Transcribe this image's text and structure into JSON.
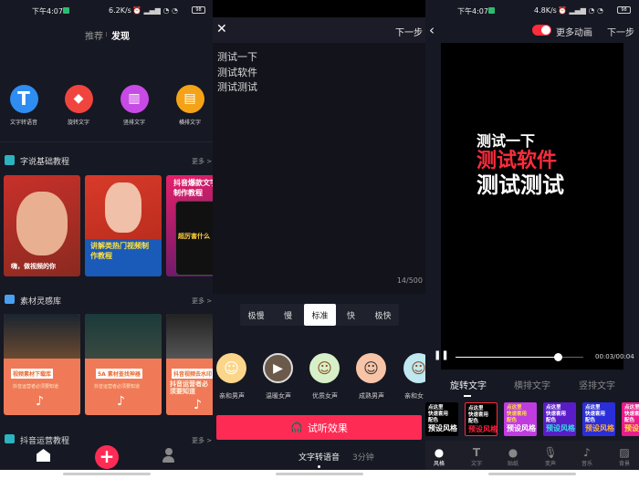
{
  "panel1": {
    "status": {
      "time": "下午4:07",
      "speed": "6.2K/s",
      "battery": "98"
    },
    "tabs": [
      {
        "label": "推荐",
        "active": false
      },
      {
        "label": "发现",
        "active": true
      }
    ],
    "tools": [
      {
        "label": "文字转语音",
        "icon": "text-t-icon",
        "color": "#2f8cf0"
      },
      {
        "label": "旋转文字",
        "icon": "rotate-text-icon",
        "color": "#f0453f"
      },
      {
        "label": "竖排文字",
        "icon": "vertical-text-icon",
        "color": "#c84ae6"
      },
      {
        "label": "横排文字",
        "icon": "horizontal-text-icon",
        "color": "#f5a316"
      }
    ],
    "sections": [
      {
        "title": "字说基础教程",
        "more": "更多 >",
        "cards": [
          {
            "caption": "嗨，做视频的你"
          },
          {
            "caption": "讲解类热门视频制作教程"
          },
          {
            "caption": "抖音爆款文字制作教程",
            "sub": "超厉害什么"
          }
        ]
      },
      {
        "title": "素材灵感库",
        "more": "更多 >",
        "cards": [
          {
            "caption": "视频素材下载库",
            "sub": "抖音运营者必须要知道"
          },
          {
            "caption": "5A 素材查找神器",
            "sub": "抖音运营者必须要知道"
          },
          {
            "caption": "抖音视频去水印",
            "sub": "抖音运营者必须要知道"
          }
        ]
      },
      {
        "title": "抖音运营教程",
        "more": "更多 >"
      }
    ],
    "nav": [
      "home-icon",
      "add-icon",
      "profile-icon"
    ]
  },
  "panel2": {
    "next": "下一步",
    "text_lines": [
      "测试一下",
      "测试软件",
      "测试测试"
    ],
    "counter": "14/500",
    "speeds": [
      {
        "label": "极慢",
        "selected": false
      },
      {
        "label": "慢",
        "selected": false
      },
      {
        "label": "标准",
        "selected": true
      },
      {
        "label": "快",
        "selected": false
      },
      {
        "label": "极快",
        "selected": false
      }
    ],
    "voices": [
      {
        "label": "亲和男声",
        "bg": "#fbd68a",
        "playing": false
      },
      {
        "label": "温暖女声",
        "bg": "#6b5a4a",
        "playing": true
      },
      {
        "label": "优质女声",
        "bg": "#d8f0c8",
        "playing": false
      },
      {
        "label": "成熟男声",
        "bg": "#f8c4a8",
        "playing": false
      },
      {
        "label": "亲和女",
        "bg": "#bfe8f0",
        "playing": false
      }
    ],
    "preview_button": "试听效果",
    "bottom_tabs": [
      {
        "label": "文字转语音",
        "active": true
      },
      {
        "label": "3分钟",
        "active": false
      }
    ],
    "accent": "#fe2c55"
  },
  "panel3": {
    "status": {
      "time": "下午4:07",
      "speed": "4.8K/s",
      "battery": "98"
    },
    "toggle_label": "更多动画",
    "toggle_on": true,
    "next": "下一步",
    "preview_lines": [
      {
        "text": "测试一下",
        "color": "#ffffff"
      },
      {
        "text": "测试软件",
        "color": "#fe2c3c"
      },
      {
        "text": "测试测试",
        "color": "#ffffff"
      }
    ],
    "time": "00:03/00:04",
    "progress": 0.8,
    "tabs": [
      {
        "label": "旋转文字",
        "active": true
      },
      {
        "label": "横排文字",
        "active": false
      },
      {
        "label": "竖排文字",
        "active": false
      }
    ],
    "tile_lines": [
      "点这里",
      "快速套用",
      "配色",
      "预设风格"
    ],
    "tiles": [
      {
        "bg": "#000000",
        "c1": "#ffffff",
        "c2": "#ffffff",
        "selected": false
      },
      {
        "bg": "#000000",
        "c1": "#ffffff",
        "c2": "#ff2040",
        "selected": true
      },
      {
        "bg": "#c03ce0",
        "c1": "#ffe040",
        "c2": "#ffffff",
        "selected": false
      },
      {
        "bg": "#5a1cc8",
        "c1": "#ffffff",
        "c2": "#30e0e0",
        "selected": false
      },
      {
        "bg": "#2a2ed8",
        "c1": "#ffffff",
        "c2": "#ffb030",
        "selected": false
      },
      {
        "bg": "#e81c8c",
        "c1": "#ffffff",
        "c2": "#ffe040",
        "selected": false
      }
    ],
    "nav": [
      {
        "label": "风格",
        "icon": "style-icon",
        "active": true
      },
      {
        "label": "文字",
        "icon": "text-icon",
        "active": false
      },
      {
        "label": "贴纸",
        "icon": "sticker-icon",
        "active": false
      },
      {
        "label": "变声",
        "icon": "microphone-icon",
        "active": false
      },
      {
        "label": "音乐",
        "icon": "music-icon",
        "active": false
      },
      {
        "label": "背景",
        "icon": "background-icon",
        "active": false
      }
    ]
  }
}
